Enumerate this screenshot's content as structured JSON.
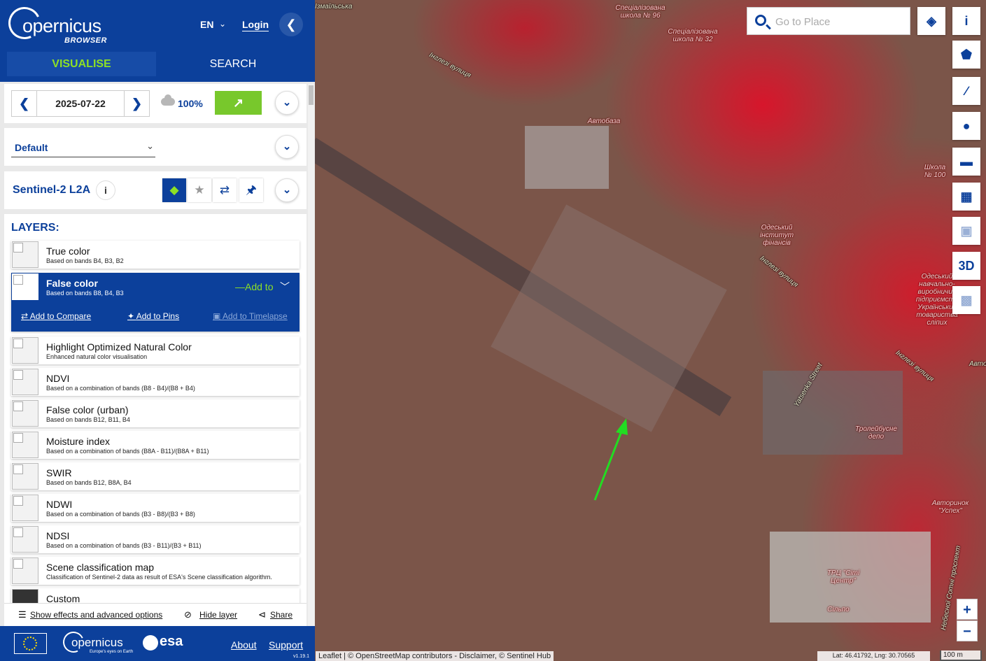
{
  "header": {
    "logo_text": "opernicus",
    "logo_sub": "BROWSER",
    "language": "EN",
    "login": "Login",
    "tabs": [
      "VISUALISE",
      "SEARCH"
    ]
  },
  "date_panel": {
    "date": "2025-07-22",
    "cloud_coverage": "100%"
  },
  "theme": {
    "selected": "Default"
  },
  "dataset": {
    "name": "Sentinel-2 L2A"
  },
  "layers": {
    "heading": "LAYERS:",
    "items": [
      {
        "title": "True color",
        "desc": "Based on bands B4, B3, B2"
      },
      {
        "title": "False color",
        "desc": "Based on bands B8, B4, B3"
      },
      {
        "title": "Highlight Optimized Natural Color",
        "desc": "Enhanced natural color visualisation"
      },
      {
        "title": "NDVI",
        "desc": "Based on a combination of bands (B8 - B4)/(B8 + B4)"
      },
      {
        "title": "False color (urban)",
        "desc": "Based on bands B12, B11, B4"
      },
      {
        "title": "Moisture index",
        "desc": "Based on a combination of bands (B8A - B11)/(B8A + B11)"
      },
      {
        "title": "SWIR",
        "desc": "Based on bands B12, B8A, B4"
      },
      {
        "title": "NDWI",
        "desc": "Based on a combination of bands (B3 - B8)/(B3 + B8)"
      },
      {
        "title": "NDSI",
        "desc": "Based on a combination of bands (B3 - B11)/(B3 + B11)"
      },
      {
        "title": "Scene classification map",
        "desc": "Classification of Sentinel-2 data as result of ESA's Scene classification algorithm."
      },
      {
        "title": "Custom",
        "desc": ""
      }
    ],
    "selected_actions": {
      "add_to": "Add to",
      "add_to_compare": "Add to Compare",
      "add_to_pins": "Add to Pins",
      "add_to_timelapse": "Add to Timelapse"
    }
  },
  "bottom_bar": {
    "effects": "Show effects and advanced options",
    "hide": "Hide layer",
    "share": "Share"
  },
  "footer": {
    "logo_text": "opernicus",
    "logo_sub": "Europe's eyes on Earth",
    "esa": "esa",
    "about": "About",
    "support": "Support",
    "version": "v1.19.1"
  },
  "map": {
    "search_placeholder": "Go to Place",
    "btn_3d": "3D",
    "zoom_in": "+",
    "zoom_out": "−",
    "attribution": "Leaflet | © OpenStreetMap contributors - Disclaimer, © Sentinel Hub",
    "coords": "Lat: 46.41792, Lng: 30.70565",
    "scale": "100 m",
    "labels": {
      "school96": "Спеціалізована школа № 96",
      "school32": "Спеціалізована школа № 32",
      "bus": "Автобаза",
      "inst": "Одеський інститут фінансів",
      "school100": "Школа № 100",
      "odesa_center": "Одеський навчально-виробничий підприємств Українських товариства сліпих",
      "trolley": "Тролейбусне депо",
      "autorynok": "Авторинок \"Успех\"",
      "trc": "ТРЦ \"Сіті Центр\"",
      "silpo": "Сільпо"
    },
    "streets": {
      "s1": "Інглезі вулиця",
      "s2": "Інглезі вулиця",
      "s3": "Інглезі вулиця",
      "s4": "Yatsenka Street",
      "s5": "Небесної Сотні проспект",
      "top1": "Ізмаїльська",
      "avto": "Авто"
    }
  }
}
